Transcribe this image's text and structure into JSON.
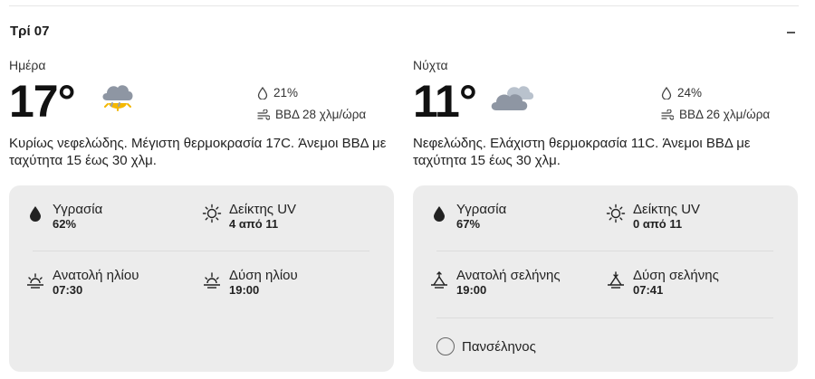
{
  "day_header": "Τρί 07",
  "collapse_icon": "minus-icon",
  "day": {
    "label": "Ημέρα",
    "temperature": "17°",
    "icon": "partly-sunny-rain-icon",
    "precip": "21%",
    "wind": "ΒΒΔ 28 χλμ/ώρα",
    "description": "Κυρίως νεφελώδης. Μέγιστη θερμοκρασία 17C. Άνεμοι ΒΒΔ με ταχύτητα 15 έως 30 χλμ.",
    "details": {
      "humidity_label": "Υγρασία",
      "humidity_value": "62%",
      "uv_label": "Δείκτης UV",
      "uv_value": "4 από 11",
      "sunrise_label": "Ανατολή ηλίου",
      "sunrise_value": "07:30",
      "sunset_label": "Δύση ηλίου",
      "sunset_value": "19:00"
    }
  },
  "night": {
    "label": "Νύχτα",
    "temperature": "11°",
    "icon": "cloudy-icon",
    "precip": "24%",
    "wind": "ΒΒΔ 26 χλμ/ώρα",
    "description": "Νεφελώδης. Ελάχιστη θερμοκρασία 11C. Άνεμοι ΒΒΔ με ταχύτητα 15 έως 30 χλμ.",
    "details": {
      "humidity_label": "Υγρασία",
      "humidity_value": "67%",
      "uv_label": "Δείκτης UV",
      "uv_value": "0 από 11",
      "moonrise_label": "Ανατολή σελήνης",
      "moonrise_value": "19:00",
      "moonset_label": "Δύση σελήνης",
      "moonset_value": "07:41",
      "moon_phase": "Πανσέληνος"
    }
  }
}
